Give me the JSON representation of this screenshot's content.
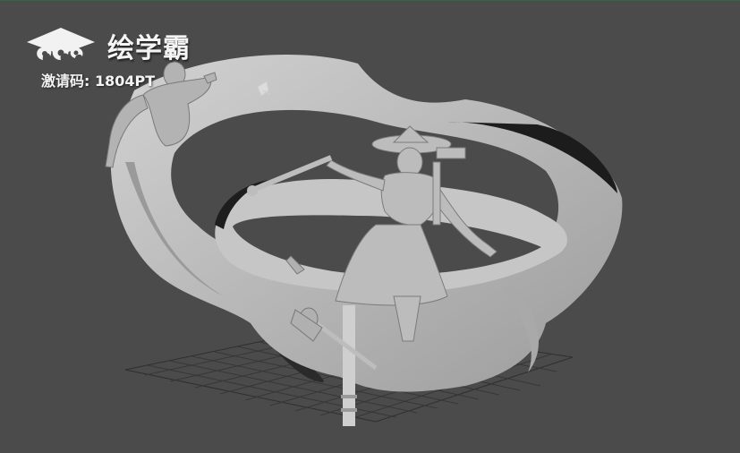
{
  "viewport": {
    "background": "#4b4b4b",
    "grid_color": "#3a3a3a",
    "model_color": "#bdbdbd"
  },
  "watermark": {
    "brand": "绘学霸",
    "invite_code": "激请码: 1804PT",
    "logo_icon": "cloud-mortarboard-icon"
  }
}
